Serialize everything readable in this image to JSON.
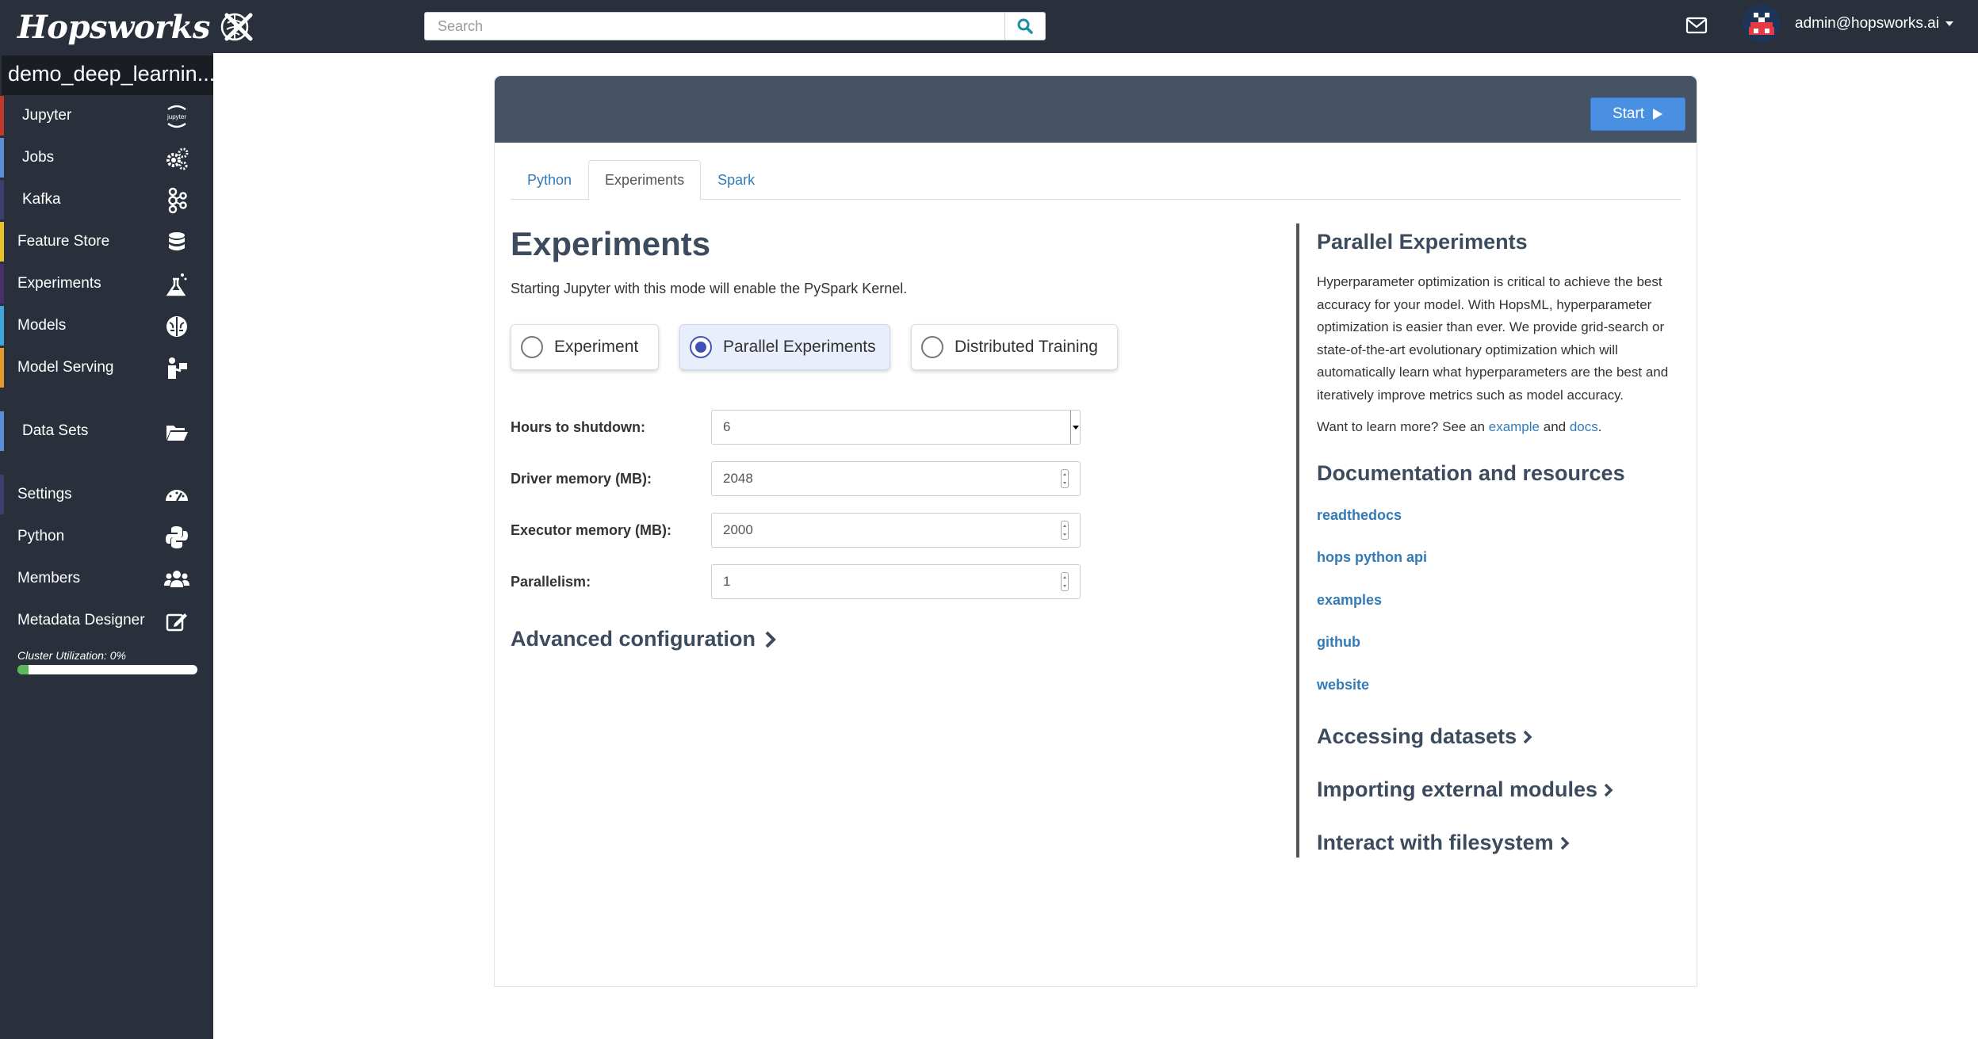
{
  "topbar": {
    "logo_text": "Hopsworks",
    "search_placeholder": "Search",
    "user_email": "admin@hopsworks.ai"
  },
  "sidebar": {
    "project_name": "demo_deep_learnin...",
    "items": [
      {
        "label": "Jupyter",
        "icon": "jupyter-icon",
        "color": "#c0392b"
      },
      {
        "label": "Jobs",
        "icon": "gears-icon",
        "color": "#5b8ed6"
      },
      {
        "label": "Kafka",
        "icon": "kafka-icon",
        "color": "#3a3f6e"
      },
      {
        "label": "Feature Store",
        "icon": "database-icon",
        "color": "#e6c229"
      },
      {
        "label": "Experiments",
        "icon": "flask-icon",
        "color": "#4a2f6b"
      },
      {
        "label": "Models",
        "icon": "brain-icon",
        "color": "#3ea6d8"
      },
      {
        "label": "Model Serving",
        "icon": "serving-icon",
        "color": "#e69a2e"
      },
      {
        "label": "Data Sets",
        "icon": "folder-open-icon",
        "color": "#5b8ed6"
      },
      {
        "label": "Settings",
        "icon": "dashboard-icon",
        "color": "#3a3f6e"
      },
      {
        "label": "Python",
        "icon": "python-icon",
        "color": "#29303b"
      },
      {
        "label": "Members",
        "icon": "users-icon",
        "color": "#29303b"
      },
      {
        "label": "Metadata Designer",
        "icon": "edit-icon",
        "color": "#29303b"
      }
    ],
    "cluster_label": "Cluster Utilization: 0%",
    "cluster_utilization_percent": 0
  },
  "panel": {
    "start_label": "Start",
    "tabs": [
      "Python",
      "Experiments",
      "Spark"
    ],
    "active_tab": "Experiments",
    "title": "Experiments",
    "description": "Starting Jupyter with this mode will enable the PySpark Kernel.",
    "modes": [
      {
        "label": "Experiment",
        "selected": false
      },
      {
        "label": "Parallel Experiments",
        "selected": true
      },
      {
        "label": "Distributed Training",
        "selected": false
      }
    ],
    "form": {
      "hours_label": "Hours to shutdown:",
      "hours_value": "6",
      "driver_label": "Driver memory (MB):",
      "driver_value": "2048",
      "executor_label": "Executor memory (MB):",
      "executor_value": "2000",
      "parallelism_label": "Parallelism:",
      "parallelism_value": "1"
    },
    "advanced_label": "Advanced configuration"
  },
  "help": {
    "title": "Parallel Experiments",
    "body": "Hyperparameter optimization is critical to achieve the best accuracy for your model. With HopsML, hyperparameter optimization is easier than ever. We provide grid-search or state-of-the-art evolutionary optimization which will automatically learn what hyperparameters are the best and iteratively improve metrics such as model accuracy.",
    "learn_prefix": "Want to learn more? See an",
    "learn_example": "example",
    "learn_and": "and",
    "learn_docs": "docs",
    "learn_suffix": ".",
    "resources_title": "Documentation and resources",
    "resources": [
      "readthedocs",
      "hops python api",
      "examples",
      "github",
      "website"
    ],
    "sections": [
      "Accessing datasets",
      "Importing external modules",
      "Interact with filesystem"
    ]
  }
}
